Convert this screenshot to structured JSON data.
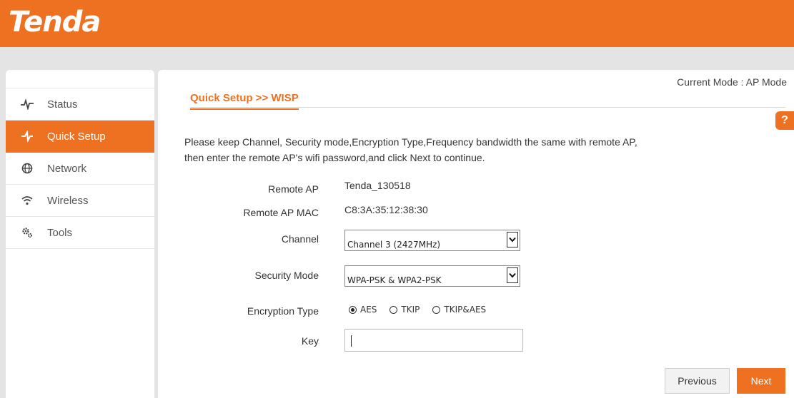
{
  "brand": {
    "logo_text": "Tenda",
    "accent": "#ee7122"
  },
  "sidebar": {
    "items": [
      {
        "label": "Status",
        "icon": "pulse-icon",
        "active": false
      },
      {
        "label": "Quick Setup",
        "icon": "magic-wand-icon",
        "active": true
      },
      {
        "label": "Network",
        "icon": "globe-icon",
        "active": false
      },
      {
        "label": "Wireless",
        "icon": "wifi-icon",
        "active": false
      },
      {
        "label": "Tools",
        "icon": "gears-icon",
        "active": false
      }
    ]
  },
  "main": {
    "current_mode": "Current Mode : AP Mode",
    "title": "Quick Setup >>  WISP",
    "help_label": "?",
    "intro_line1": "Please keep Channel, Security mode,Encryption Type,Frequency bandwidth the same with remote AP,",
    "intro_line2": "then enter the remote AP's wifi password,and click Next to continue.",
    "form": {
      "remote_ap_label": "Remote AP",
      "remote_ap_value": "Tenda_130518",
      "remote_mac_label": "Remote AP MAC",
      "remote_mac_value": "C8:3A:35:12:38:30",
      "channel_label": "Channel",
      "channel_value": "Channel 3 (2427MHz)",
      "security_label": "Security Mode",
      "security_value": "WPA-PSK & WPA2-PSK",
      "encryption_label": "Encryption Type",
      "encryption_options": [
        "AES",
        "TKIP",
        "TKIP&AES"
      ],
      "encryption_selected": "AES",
      "key_label": "Key",
      "key_value": ""
    },
    "buttons": {
      "previous": "Previous",
      "next": "Next"
    }
  }
}
